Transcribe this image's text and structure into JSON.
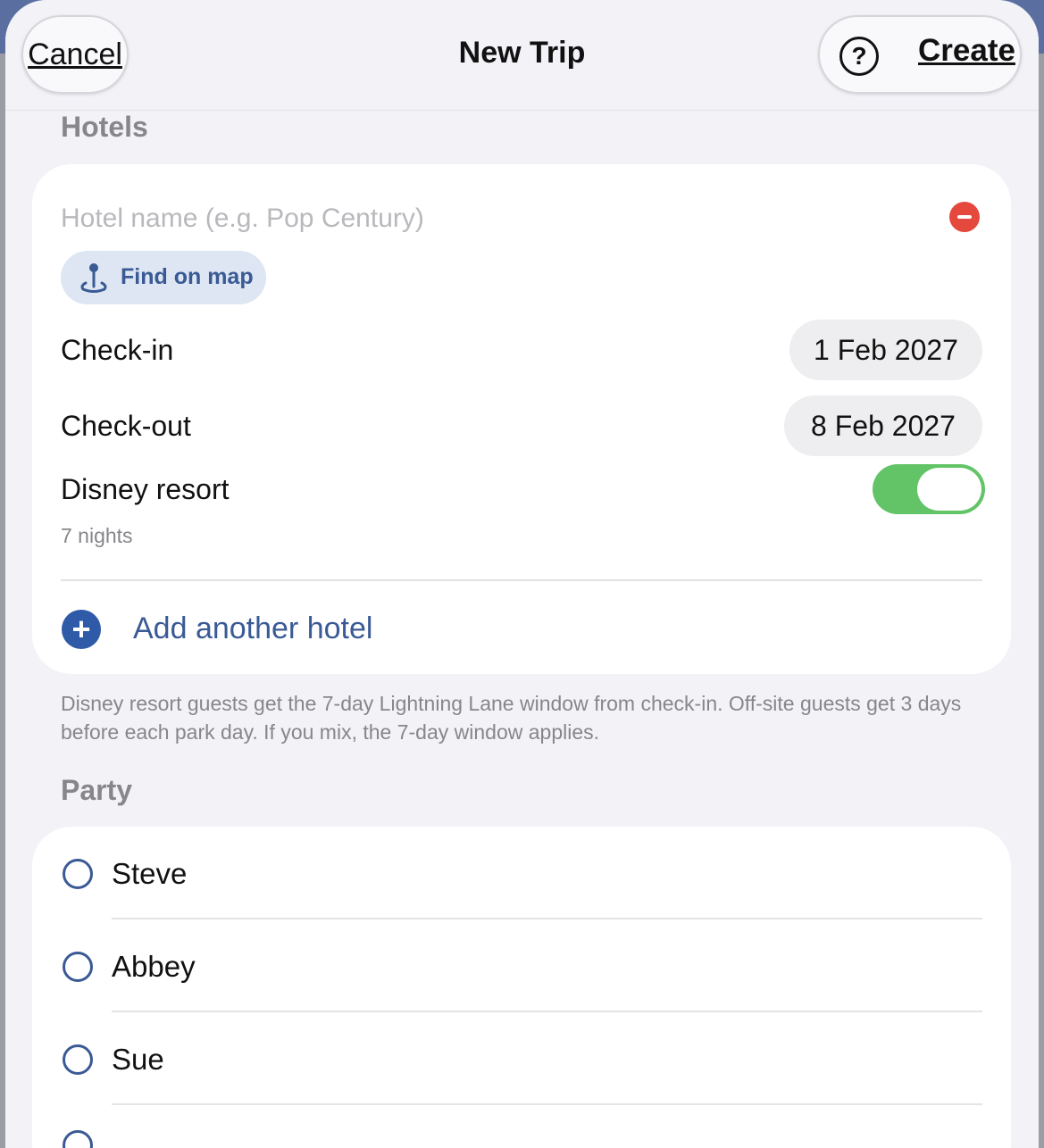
{
  "navbar": {
    "cancel_label": "Cancel",
    "title": "New Trip",
    "help_icon": "question-circle-icon",
    "create_label": "Create"
  },
  "hotels": {
    "section_title": "Hotels",
    "name_placeholder": "Hotel name (e.g. Pop Century)",
    "find_on_map_label": "Find on map",
    "checkin_label": "Check-in",
    "checkin_value": "1 Feb 2027",
    "checkout_label": "Check-out",
    "checkout_value": "8 Feb 2027",
    "disney_resort_label": "Disney resort",
    "disney_resort_on": true,
    "nights": "7 nights",
    "add_hotel_label": "Add another hotel",
    "footnote": "Disney resort guests get the 7-day Lightning Lane window from check-in. Off-site guests get 3 days before each park day. If you mix, the 7-day window applies."
  },
  "party": {
    "section_title": "Party",
    "members": [
      {
        "name": "Steve",
        "selected": false
      },
      {
        "name": "Abbey",
        "selected": false
      },
      {
        "name": "Sue",
        "selected": false
      }
    ]
  },
  "colors": {
    "accent": "#3a5a95",
    "toggle_on": "#62c466",
    "destructive": "#e5483d"
  }
}
